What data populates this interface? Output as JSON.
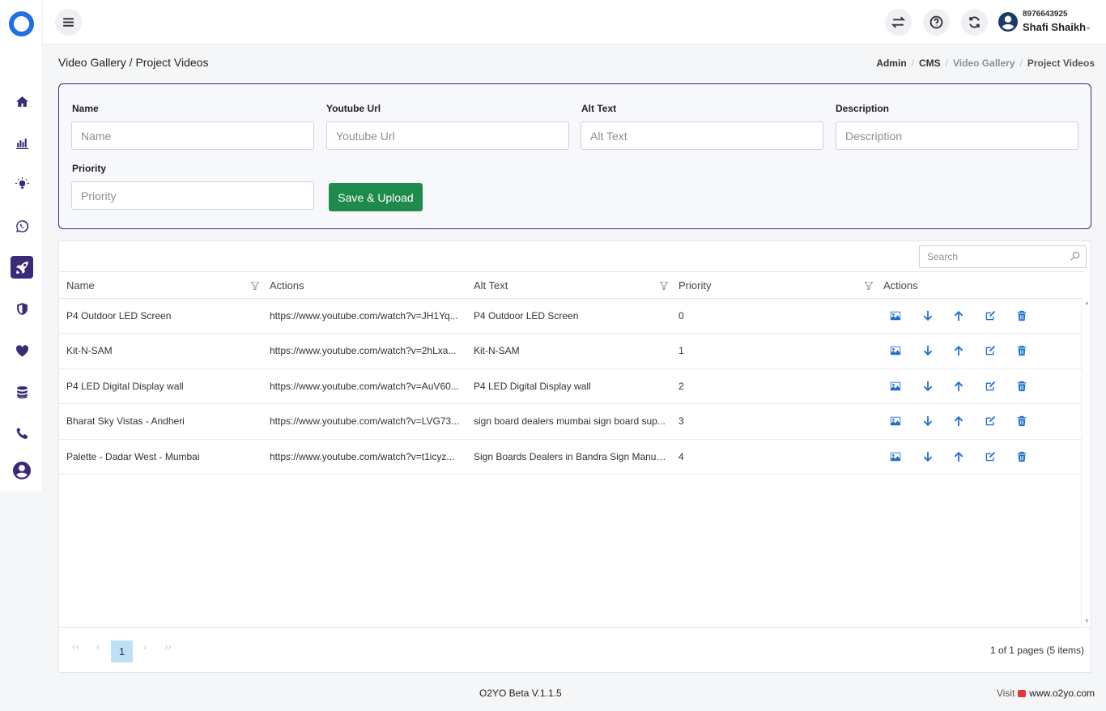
{
  "colors": {
    "brand_purple": "#3b2a7a",
    "brand_blue": "#1f6fe5",
    "save_green": "#1e8a4c",
    "action_blue": "#1f6fd0"
  },
  "sidebar": {
    "items": [
      {
        "icon": "home-icon"
      },
      {
        "icon": "bar-chart-icon"
      },
      {
        "icon": "lightbulb-icon"
      },
      {
        "icon": "whatsapp-icon"
      },
      {
        "icon": "rocket-icon",
        "active": true
      },
      {
        "icon": "shield-icon"
      },
      {
        "icon": "heart-icon"
      },
      {
        "icon": "database-icon"
      },
      {
        "icon": "phone-icon"
      },
      {
        "icon": "user-circle-icon"
      }
    ]
  },
  "topbar": {
    "user_phone": "8976643925",
    "user_name": "Shafi Shaikh"
  },
  "page": {
    "title": "Video Gallery / Project Videos",
    "breadcrumb": [
      "Admin",
      "CMS",
      "Video Gallery",
      "Project Videos"
    ]
  },
  "form": {
    "name_label": "Name",
    "name_placeholder": "Name",
    "youtube_label": "Youtube Url",
    "youtube_placeholder": "Youtube Url",
    "alt_label": "Alt Text",
    "alt_placeholder": "Alt Text",
    "description_label": "Description",
    "description_placeholder": "Description",
    "priority_label": "Priority",
    "priority_placeholder": "Priority",
    "save_label": "Save & Upload"
  },
  "grid": {
    "search_placeholder": "Search",
    "columns": [
      "Name",
      "Actions",
      "Alt Text",
      "Priority",
      "Actions"
    ],
    "rows": [
      {
        "name": "P4 Outdoor LED Screen",
        "url": "https://www.youtube.com/watch?v=JH1Yq...",
        "alt": "P4 Outdoor LED Screen",
        "priority": "0"
      },
      {
        "name": "Kit-N-SAM",
        "url": "https://www.youtube.com/watch?v=2hLxa...",
        "alt": "Kit-N-SAM",
        "priority": "1"
      },
      {
        "name": "P4 LED Digital Display wall",
        "url": "https://www.youtube.com/watch?v=AuV60...",
        "alt": "P4 LED Digital Display wall",
        "priority": "2"
      },
      {
        "name": "Bharat Sky Vistas - Andheri",
        "url": "https://www.youtube.com/watch?v=LVG73...",
        "alt": "sign board dealers mumbai sign board sup...",
        "priority": "3"
      },
      {
        "name": "Palette - Dadar West - Mumbai",
        "url": "https://www.youtube.com/watch?v=t1icyz...",
        "alt": "Sign Boards Dealers in Bandra Sign Manufa...",
        "priority": "4"
      }
    ],
    "row_actions": [
      "image-icon",
      "arrow-down-icon",
      "arrow-up-icon",
      "edit-icon",
      "trash-icon"
    ],
    "pager": {
      "current_page": "1",
      "info": "1 of 1 pages (5 items)"
    }
  },
  "footer": {
    "version": "O2YO Beta V.1.1.5",
    "visit_label": "Visit",
    "site": "www.o2yo.com"
  }
}
